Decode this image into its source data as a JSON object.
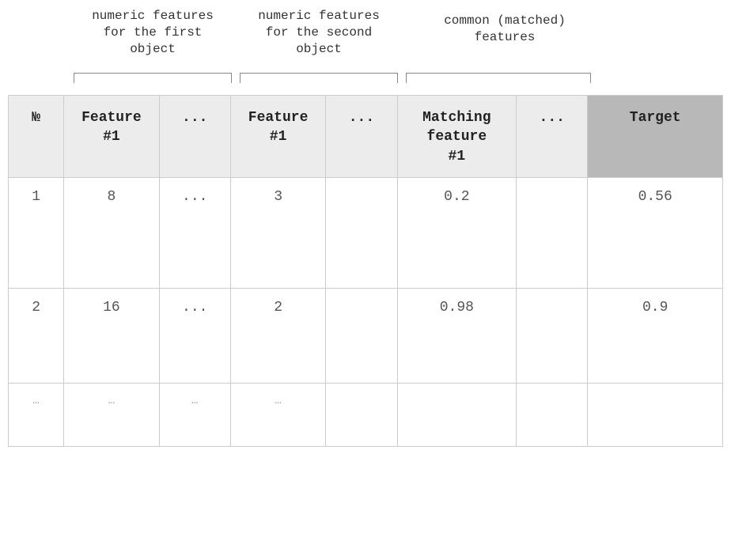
{
  "annotations": {
    "group1": "numeric features\nfor the first\nobject",
    "group2": "numeric features\nfor the second\nobject",
    "group3": "common (matched)\nfeatures"
  },
  "headers": {
    "num": "№",
    "feature1_a": "Feature\n#1",
    "ellipsis1": "...",
    "feature1_b": "Feature\n#1",
    "ellipsis2": "...",
    "matching": "Matching\nfeature\n#1",
    "ellipsis3": "...",
    "target": "Target"
  },
  "rows": [
    {
      "num": "1",
      "f1a": "8",
      "e1": "...",
      "f1b": "3",
      "e2": "",
      "match": "0.2",
      "e3": "",
      "target": "0.56"
    },
    {
      "num": "2",
      "f1a": "16",
      "e1": "...",
      "f1b": "2",
      "e2": "",
      "match": "0.98",
      "e3": "",
      "target": "0.9"
    }
  ],
  "ellipsis_row": {
    "num": "…",
    "f1a": "…",
    "e1": "…",
    "f1b": "…",
    "e2": "",
    "match": "",
    "e3": "",
    "target": ""
  }
}
